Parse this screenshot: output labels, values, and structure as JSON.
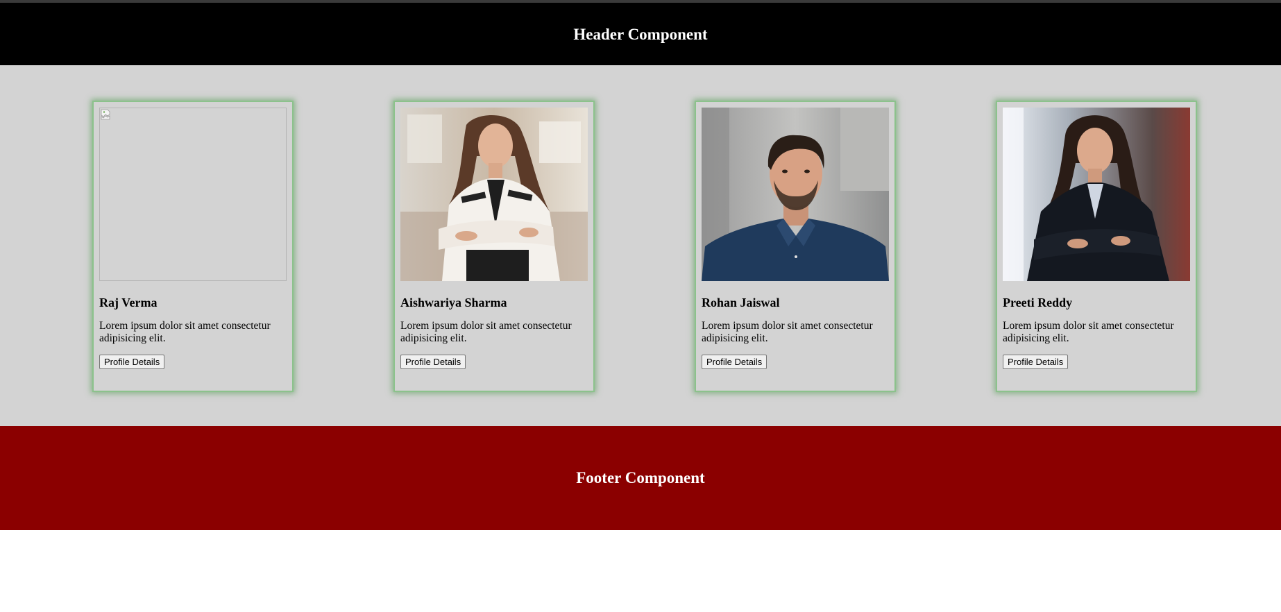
{
  "header": {
    "title": "Header Component"
  },
  "footer": {
    "title": "Footer Component"
  },
  "colors": {
    "header_bg": "#000000",
    "main_bg": "#d3d3d3",
    "footer_bg": "#8b0000",
    "card_glow": "#8cc28c"
  },
  "cards": [
    {
      "name": "Raj Verma",
      "description": "Lorem ipsum dolor sit amet consectetur adipisicing elit.",
      "button": "Profile Details",
      "photo": "broken-image"
    },
    {
      "name": "Aishwariya Sharma",
      "description": "Lorem ipsum dolor sit amet consectetur adipisicing elit.",
      "button": "Profile Details",
      "photo": "woman-white-blazer-portrait"
    },
    {
      "name": "Rohan Jaiswal",
      "description": "Lorem ipsum dolor sit amet consectetur adipisicing elit.",
      "button": "Profile Details",
      "photo": "man-navy-shirt-portrait"
    },
    {
      "name": "Preeti Reddy",
      "description": "Lorem ipsum dolor sit amet consectetur adipisicing elit.",
      "button": "Profile Details",
      "photo": "woman-black-blazer-portrait"
    }
  ]
}
